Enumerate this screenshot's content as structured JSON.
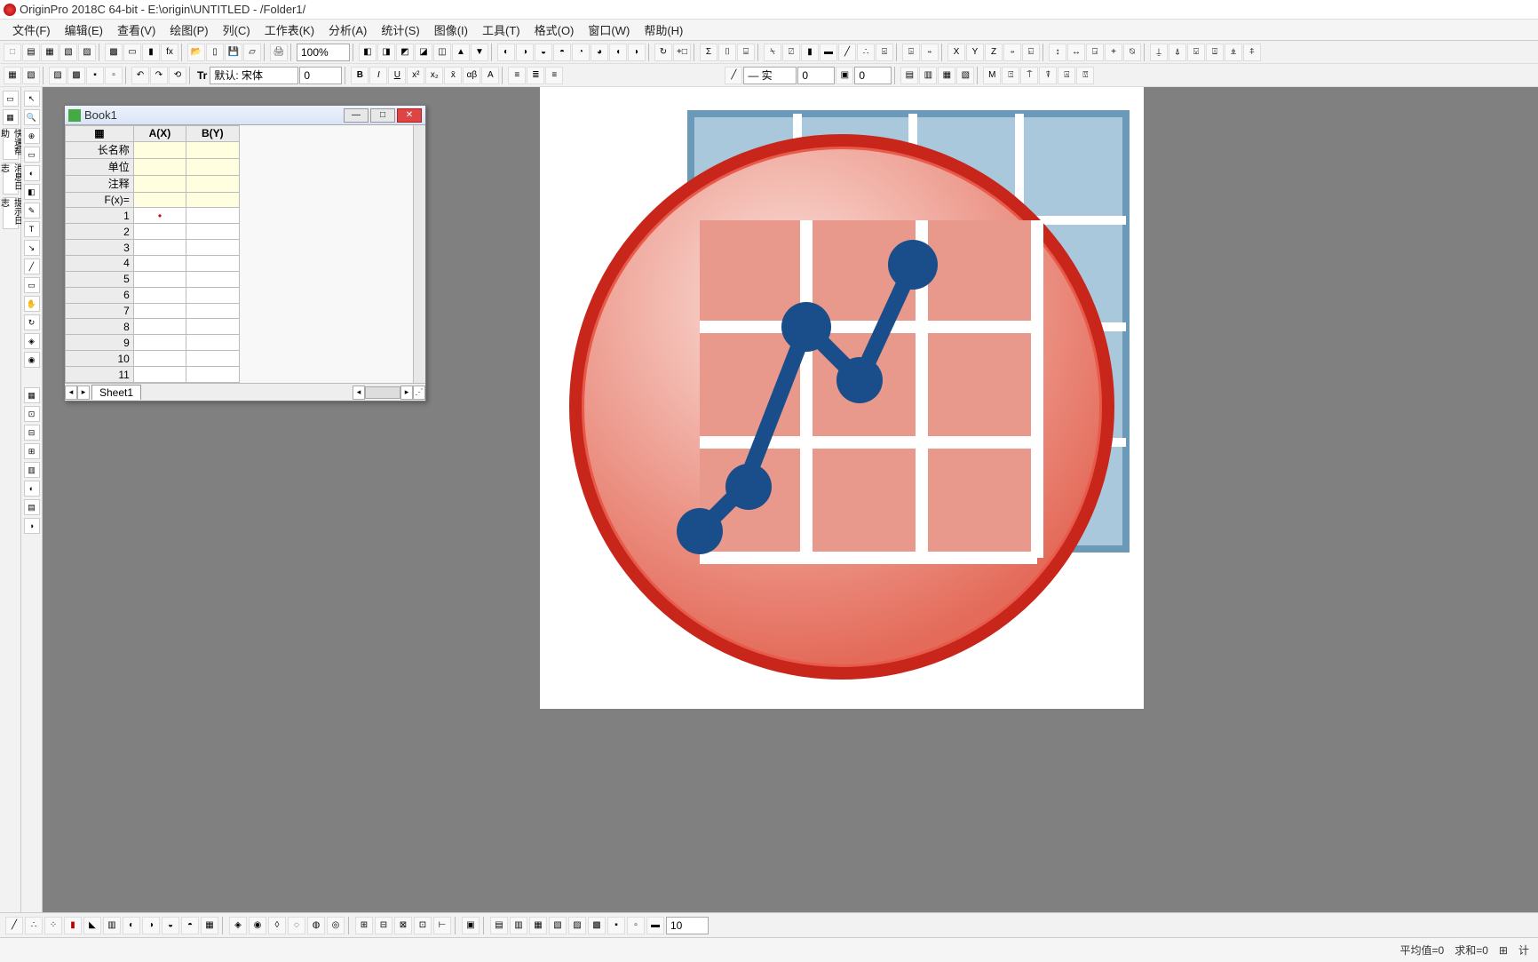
{
  "app": {
    "title": "OriginPro 2018C 64-bit - E:\\origin\\UNTITLED - /Folder1/"
  },
  "menu": {
    "file": "文件(F)",
    "edit": "编辑(E)",
    "view": "查看(V)",
    "plot": "绘图(P)",
    "column": "列(C)",
    "worksheet": "工作表(K)",
    "analysis": "分析(A)",
    "statistics": "统计(S)",
    "image": "图像(I)",
    "tools": "工具(T)",
    "format": "格式(O)",
    "window": "窗口(W)",
    "help": "帮助(H)"
  },
  "toolbar": {
    "zoom": "100%",
    "font_label": "默认: 宋体",
    "font_size": "0",
    "line_style": "— 实",
    "size1": "0",
    "size2": "0",
    "bottom_size": "10"
  },
  "book": {
    "title": "Book1",
    "col_a": "A(X)",
    "col_b": "B(Y)",
    "row_longname": "长名称",
    "row_unit": "单位",
    "row_comment": "注释",
    "row_fx": "F(x)=",
    "rows": [
      "1",
      "2",
      "3",
      "4",
      "5",
      "6",
      "7",
      "8",
      "9",
      "10",
      "11"
    ],
    "sheet_name": "Sheet1"
  },
  "status": {
    "avg": "平均值=0",
    "sum": "求和=0",
    "count": "计"
  },
  "side_labels": {
    "quick_help": "快速帮助",
    "msg_log": "消息日志",
    "hint_log": "提示日志"
  }
}
